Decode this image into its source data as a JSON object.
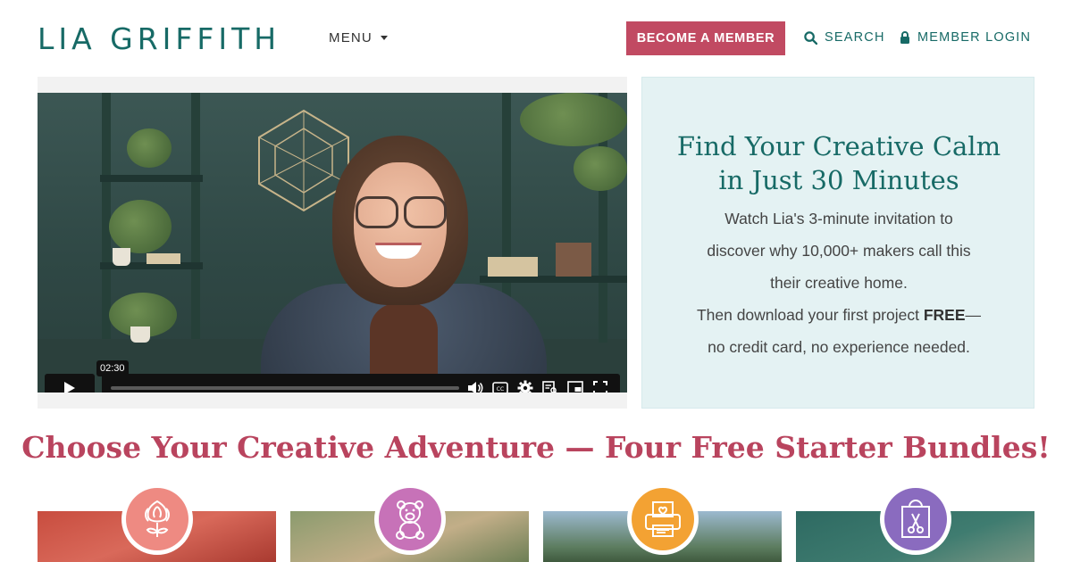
{
  "header": {
    "logo_text": "LIA GRIFFITH",
    "menu_label": "MENU",
    "member_button": "BECOME A MEMBER",
    "search_label": "SEARCH",
    "login_label": "MEMBER LOGIN"
  },
  "video": {
    "time_tooltip": "02:30",
    "progress": 0.0,
    "controls": [
      "play-icon",
      "volume-icon",
      "captions-icon",
      "settings-icon",
      "transcript-icon",
      "picture-in-picture-icon",
      "fullscreen-icon"
    ]
  },
  "callout": {
    "title_line1": "Find Your Creative Calm",
    "title_line2": "in Just 30 Minutes",
    "body_line1": "Watch Lia's 3-minute invitation to",
    "body_line2": "discover why 10,000+ makers call this",
    "body_line3": "their creative home.",
    "body_line4_pre": "Then download your first project ",
    "body_line4_bold": "FREE",
    "body_line4_post": "—",
    "body_line5": "no credit card, no experience needed."
  },
  "section": {
    "title": "Choose Your Creative Adventure — Four Free Starter Bundles!"
  },
  "bundles": [
    {
      "icon": "flower-icon",
      "badge_color": "#ee8a82"
    },
    {
      "icon": "teddy-bear-icon",
      "badge_color": "#c772b8"
    },
    {
      "icon": "printer-icon",
      "badge_color": "#f3a233"
    },
    {
      "icon": "shopping-bag-icon",
      "badge_color": "#8a6bbf"
    }
  ],
  "colors": {
    "brand_teal": "#176a66",
    "accent_pink": "#c14a62",
    "heading_pink": "#b9445e",
    "callout_bg": "#e4f2f3"
  }
}
